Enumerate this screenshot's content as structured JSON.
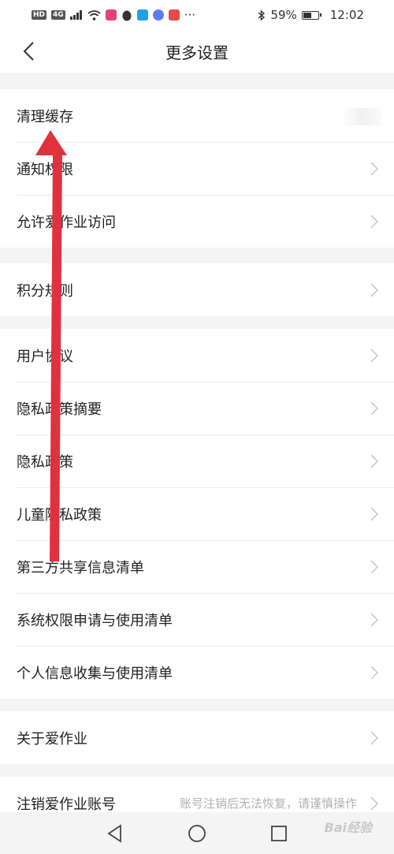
{
  "status_bar": {
    "left_chips": [
      "HD",
      "4G"
    ],
    "battery": "59%",
    "battery_level": 0.59,
    "time": "12:02",
    "more": "···"
  },
  "header": {
    "title": "更多设置"
  },
  "groups": [
    {
      "items": [
        {
          "label": "清理缓存",
          "has_chevron": false
        },
        {
          "label": "通知权限",
          "has_chevron": true
        },
        {
          "label": "允许爱作业访问",
          "has_chevron": true
        }
      ]
    },
    {
      "items": [
        {
          "label": "积分规则",
          "has_chevron": true
        }
      ]
    },
    {
      "items": [
        {
          "label": "用户协议",
          "has_chevron": true
        },
        {
          "label": "隐私政策摘要",
          "has_chevron": true
        },
        {
          "label": "隐私政策",
          "has_chevron": true
        },
        {
          "label": "儿童隐私政策",
          "has_chevron": true
        },
        {
          "label": "第三方共享信息清单",
          "has_chevron": true
        },
        {
          "label": "系统权限申请与使用清单",
          "has_chevron": true
        },
        {
          "label": "个人信息收集与使用清单",
          "has_chevron": true
        }
      ]
    },
    {
      "items": [
        {
          "label": "关于爱作业",
          "has_chevron": true
        }
      ]
    },
    {
      "items": [
        {
          "label": "注销爱作业账号",
          "note": "账号注销后无法恢复，请谨慎操作",
          "has_chevron": true
        }
      ]
    }
  ],
  "watermark": "Bai经验",
  "colors": {
    "annotation_arrow": "#e0323e",
    "chevron": "#c4c4c4"
  },
  "icons": [
    "back-arrow-icon",
    "chevron-right-icon",
    "nav-back-icon",
    "nav-home-icon",
    "nav-recents-icon"
  ]
}
